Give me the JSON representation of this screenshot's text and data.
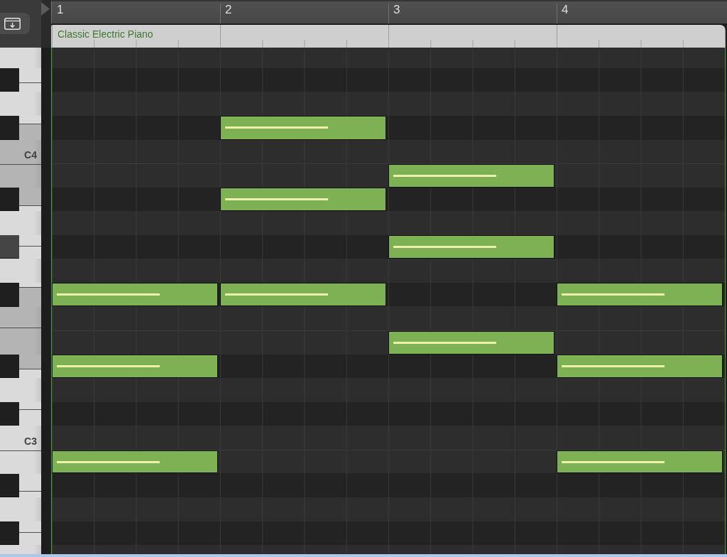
{
  "ruler": {
    "bars": [
      "1",
      "2",
      "3",
      "4"
    ]
  },
  "region": {
    "title": "Classic Electric Piano"
  },
  "keyboard": {
    "white_keys": [
      {
        "highlighted": false
      },
      {
        "highlighted": false
      },
      {
        "label": "C4",
        "highlighted": true
      },
      {
        "highlighted": true
      },
      {
        "highlighted": false
      },
      {
        "highlighted": false
      },
      {
        "highlighted": true
      },
      {
        "highlighted": true
      },
      {
        "highlighted": false
      },
      {
        "label": "C3",
        "highlighted": false
      },
      {
        "highlighted": false
      },
      {
        "highlighted": false
      },
      {
        "highlighted": false
      }
    ],
    "black_keys": [
      {
        "highlighted": false
      },
      {
        "highlighted": false
      },
      {
        "highlighted": false
      },
      {
        "highlighted": true
      },
      {
        "highlighted": false
      },
      {
        "highlighted": false
      },
      {
        "highlighted": false
      },
      {
        "highlighted": false
      },
      {
        "highlighted": false
      }
    ]
  },
  "piano_roll": {
    "rows": [
      {
        "kind": "white",
        "notes": [
          {
            "kind": "rest"
          },
          {
            "kind": "rest"
          },
          {
            "kind": "rest"
          },
          {
            "kind": "rest"
          }
        ]
      },
      {
        "kind": "black",
        "notes": [
          {
            "kind": "rest"
          },
          {
            "kind": "rest"
          },
          {
            "kind": "rest"
          },
          {
            "kind": "rest"
          }
        ]
      },
      {
        "kind": "white",
        "notes": [
          {
            "kind": "rest"
          },
          {
            "kind": "rest"
          },
          {
            "kind": "rest"
          },
          {
            "kind": "rest"
          }
        ]
      },
      {
        "kind": "black",
        "notes": [
          {
            "kind": "rest"
          },
          {
            "kind": "note",
            "level": 0.65
          },
          {
            "kind": "rest"
          },
          {
            "kind": "rest"
          }
        ]
      },
      {
        "kind": "white",
        "notes": [
          {
            "kind": "rest"
          },
          {
            "kind": "rest"
          },
          {
            "kind": "rest"
          },
          {
            "kind": "rest"
          }
        ]
      },
      {
        "kind": "white",
        "notes": [
          {
            "kind": "rest"
          },
          {
            "kind": "rest"
          },
          {
            "kind": "note",
            "level": 0.65
          },
          {
            "kind": "rest"
          }
        ]
      },
      {
        "kind": "black",
        "notes": [
          {
            "kind": "rest"
          },
          {
            "kind": "note",
            "level": 0.65
          },
          {
            "kind": "rest"
          },
          {
            "kind": "rest"
          }
        ]
      },
      {
        "kind": "white",
        "notes": [
          {
            "kind": "rest"
          },
          {
            "kind": "rest"
          },
          {
            "kind": "rest"
          },
          {
            "kind": "rest"
          }
        ]
      },
      {
        "kind": "black",
        "notes": [
          {
            "kind": "rest"
          },
          {
            "kind": "rest"
          },
          {
            "kind": "note",
            "level": 0.65
          },
          {
            "kind": "rest"
          }
        ]
      },
      {
        "kind": "white",
        "notes": [
          {
            "kind": "rest"
          },
          {
            "kind": "rest"
          },
          {
            "kind": "rest"
          },
          {
            "kind": "rest"
          }
        ]
      },
      {
        "kind": "black",
        "notes": [
          {
            "kind": "note",
            "level": 0.65
          },
          {
            "kind": "note",
            "level": 0.65
          },
          {
            "kind": "rest"
          },
          {
            "kind": "note",
            "level": 0.65
          }
        ]
      },
      {
        "kind": "white",
        "notes": [
          {
            "kind": "rest"
          },
          {
            "kind": "rest"
          },
          {
            "kind": "rest"
          },
          {
            "kind": "rest"
          }
        ]
      },
      {
        "kind": "white",
        "notes": [
          {
            "kind": "rest"
          },
          {
            "kind": "rest"
          },
          {
            "kind": "note",
            "level": 0.65
          },
          {
            "kind": "rest"
          }
        ]
      },
      {
        "kind": "black",
        "notes": [
          {
            "kind": "note",
            "level": 0.65
          },
          {
            "kind": "rest"
          },
          {
            "kind": "rest"
          },
          {
            "kind": "note",
            "level": 0.65
          }
        ]
      },
      {
        "kind": "white",
        "notes": [
          {
            "kind": "rest"
          },
          {
            "kind": "rest"
          },
          {
            "kind": "rest"
          },
          {
            "kind": "rest"
          }
        ]
      },
      {
        "kind": "black",
        "notes": [
          {
            "kind": "rest"
          },
          {
            "kind": "rest"
          },
          {
            "kind": "rest"
          },
          {
            "kind": "rest"
          }
        ]
      },
      {
        "kind": "white",
        "notes": [
          {
            "kind": "rest"
          },
          {
            "kind": "rest"
          },
          {
            "kind": "rest"
          },
          {
            "kind": "rest"
          }
        ]
      },
      {
        "kind": "white",
        "notes": [
          {
            "kind": "note",
            "level": 0.65
          },
          {
            "kind": "rest"
          },
          {
            "kind": "rest"
          },
          {
            "kind": "note",
            "level": 0.65
          }
        ]
      },
      {
        "kind": "black",
        "notes": [
          {
            "kind": "rest"
          },
          {
            "kind": "rest"
          },
          {
            "kind": "rest"
          },
          {
            "kind": "rest"
          }
        ]
      },
      {
        "kind": "white",
        "notes": [
          {
            "kind": "rest"
          },
          {
            "kind": "rest"
          },
          {
            "kind": "rest"
          },
          {
            "kind": "rest"
          }
        ]
      },
      {
        "kind": "black",
        "notes": [
          {
            "kind": "rest"
          },
          {
            "kind": "rest"
          },
          {
            "kind": "rest"
          },
          {
            "kind": "rest"
          }
        ]
      },
      {
        "kind": "white",
        "notes": [
          {
            "kind": "rest"
          },
          {
            "kind": "rest"
          },
          {
            "kind": "rest"
          },
          {
            "kind": "rest"
          }
        ]
      }
    ]
  }
}
